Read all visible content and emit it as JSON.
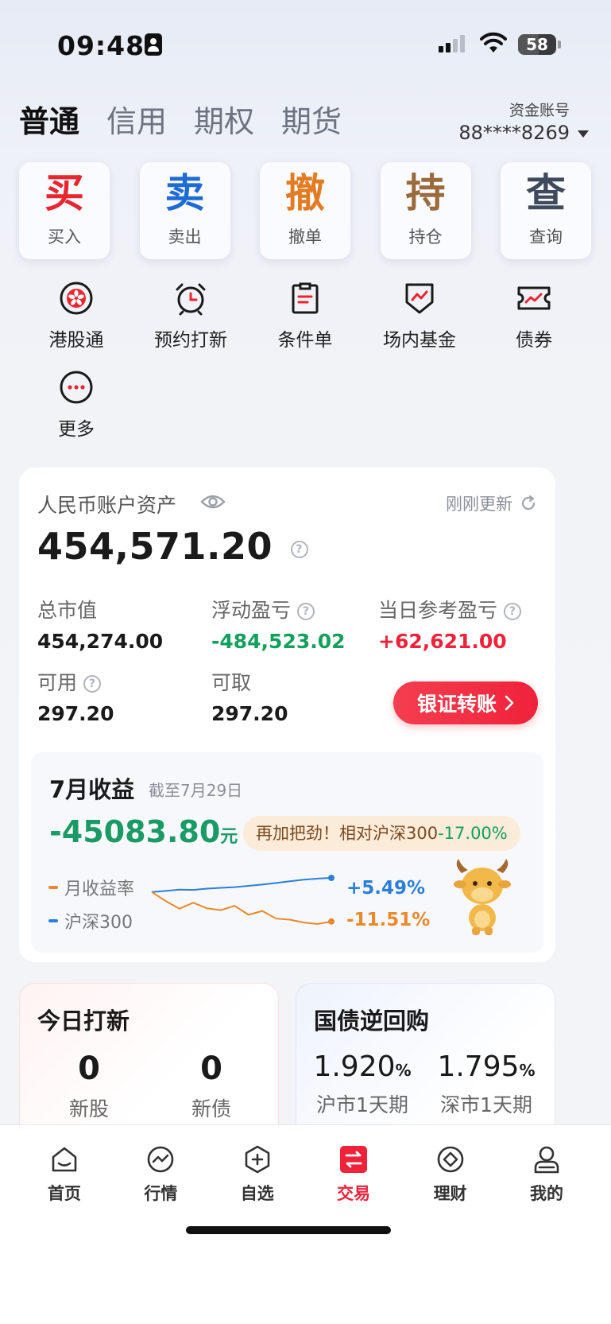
{
  "status_bar": {
    "time": "09:48",
    "battery": "58"
  },
  "tabs": [
    {
      "label": "普通",
      "active": true
    },
    {
      "label": "信用",
      "active": false
    },
    {
      "label": "期权",
      "active": false
    },
    {
      "label": "期货",
      "active": false
    }
  ],
  "account": {
    "label": "资金账号",
    "number": "88****8269"
  },
  "big_buttons": [
    {
      "glyph": "买",
      "label": "买入",
      "color": "#e8262f"
    },
    {
      "glyph": "卖",
      "label": "卖出",
      "color": "#1f6bd6"
    },
    {
      "glyph": "撤",
      "label": "撤单",
      "color": "#e27b22"
    },
    {
      "glyph": "持",
      "label": "持仓",
      "color": "#9c6b3d"
    },
    {
      "glyph": "查",
      "label": "查询",
      "color": "#3f4a5c"
    }
  ],
  "quick_items": [
    {
      "label": "港股通",
      "icon": "hk-flower-icon"
    },
    {
      "label": "预约打新",
      "icon": "alarm-clock-icon"
    },
    {
      "label": "条件单",
      "icon": "clipboard-icon"
    },
    {
      "label": "场内基金",
      "icon": "fund-shield-icon"
    },
    {
      "label": "债券",
      "icon": "bond-ticket-icon"
    },
    {
      "label": "更多",
      "icon": "more-dots-icon"
    }
  ],
  "asset": {
    "title": "人民币账户资产",
    "refresh_label": "刚刚更新",
    "total": "454,571.20",
    "market_value_label": "总市值",
    "market_value": "454,274.00",
    "floating_pl_label": "浮动盈亏",
    "floating_pl": "-484,523.02",
    "daily_pl_label": "当日参考盈亏",
    "daily_pl": "+62,621.00",
    "available_label": "可用",
    "available": "297.20",
    "withdrawable_label": "可取",
    "withdrawable": "297.20",
    "transfer_button": "银证转账"
  },
  "monthly": {
    "title": "7月收益",
    "as_of": "截至7月29日",
    "value": "-45083.80",
    "unit": "元",
    "cheer_prefix": "再加把劲！相对沪深300",
    "cheer_value": "-17.00%",
    "series": [
      {
        "name": "月收益率",
        "value": "-11.51%",
        "color": "#e8892b"
      },
      {
        "name": "沪深300",
        "value": "+5.49%",
        "color": "#2c7fd8"
      }
    ]
  },
  "chart_data": {
    "type": "line",
    "series": [
      {
        "name": "沪深300",
        "values": [
          0,
          0.4,
          0.9,
          0.8,
          1.3,
          1.6,
          1.9,
          2.4,
          2.9,
          3.5,
          4.2,
          4.8,
          5.2,
          5.49
        ]
      },
      {
        "name": "月收益率",
        "values": [
          0,
          -3.5,
          -6.5,
          -4.2,
          -6.4,
          -7.1,
          -5.4,
          -8.9,
          -7.4,
          -10.4,
          -10.8,
          -11.9,
          -12.5,
          -11.51
        ]
      }
    ]
  },
  "new_issues": {
    "title": "今日打新",
    "stocks_count": "0",
    "stocks_label": "新股",
    "bonds_count": "0",
    "bonds_label": "新债"
  },
  "repo": {
    "title": "国债逆回购",
    "sh_rate": "1.920",
    "sh_label": "沪市1天期",
    "sz_rate": "1.795",
    "sz_label": "深市1天期",
    "pct": "%"
  },
  "tabbar": [
    {
      "label": "首页",
      "icon": "home-icon",
      "active": false
    },
    {
      "label": "行情",
      "icon": "market-icon",
      "active": false
    },
    {
      "label": "自选",
      "icon": "watchlist-icon",
      "active": false
    },
    {
      "label": "交易",
      "icon": "trade-icon",
      "active": true
    },
    {
      "label": "理财",
      "icon": "wealth-icon",
      "active": false
    },
    {
      "label": "我的",
      "icon": "profile-icon",
      "active": false
    }
  ]
}
